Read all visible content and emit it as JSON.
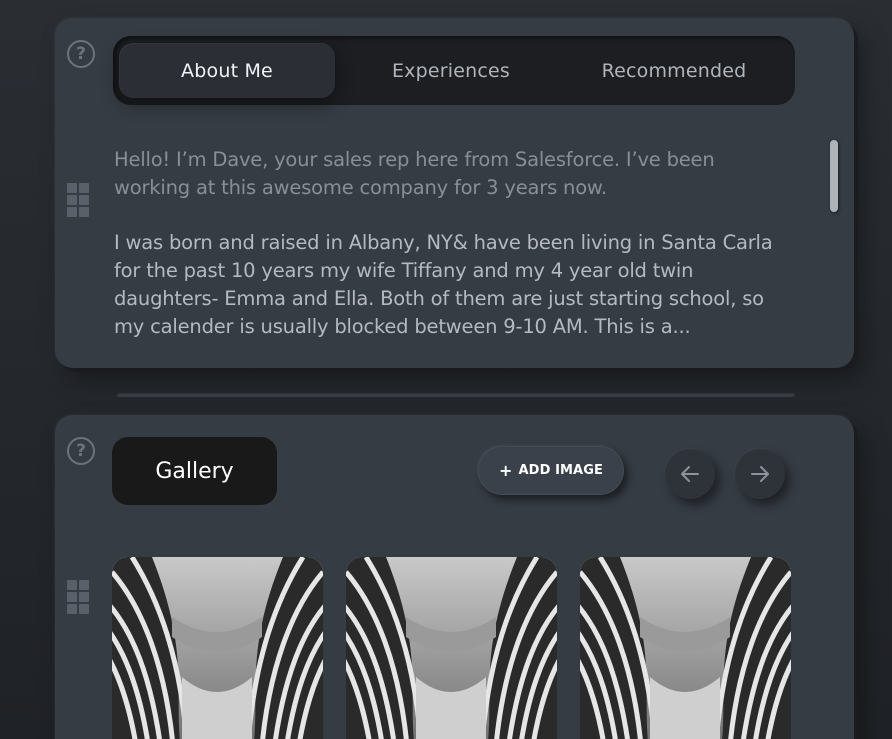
{
  "about_card": {
    "help_icon": "?",
    "tabs": [
      {
        "label": "About Me",
        "active": true
      },
      {
        "label": "Experiences",
        "active": false
      },
      {
        "label": "Recommended",
        "active": false
      }
    ],
    "paragraph_1": "Hello! I’m Dave, your sales rep here from Salesforce. I’ve been working at this awesome company for 3 years now.",
    "paragraph_2": "I was born and raised in Albany, NY& have been living in Santa Carla for the past 10 years my wife Tiffany and my 4 year old twin daughters- Emma and Ella. Both of them are just starting school, so my calender is usually blocked between 9-10 AM. This is a..."
  },
  "gallery_card": {
    "help_icon": "?",
    "title": "Gallery",
    "add_image": {
      "icon": "+",
      "label": "ADD IMAGE"
    },
    "prev_icon": "arrow-left-icon",
    "next_icon": "arrow-right-icon",
    "images": [
      {
        "alt": "abstract-architecture-image"
      },
      {
        "alt": "abstract-architecture-image"
      },
      {
        "alt": "abstract-architecture-image"
      }
    ]
  },
  "colors": {
    "background": "#24282c",
    "card": "#363c44",
    "tab_bar": "#1c1e21",
    "active_tab": "#2b2f35",
    "text": "#b5b9c0"
  }
}
